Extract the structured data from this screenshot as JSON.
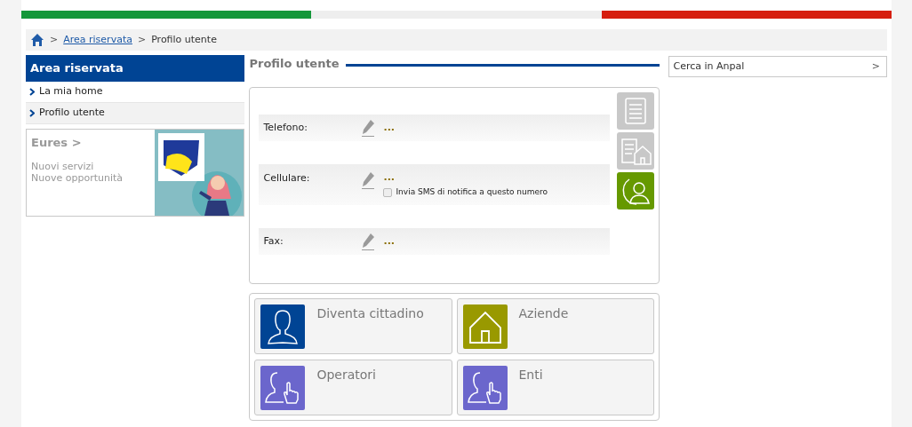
{
  "breadcrumb": {
    "links": [
      "Area riservata"
    ],
    "separator": ">",
    "current": "Profilo utente"
  },
  "sidebar": {
    "title": "Area riservata",
    "items": [
      {
        "label": "La mia home",
        "selected": false
      },
      {
        "label": "Profilo utente",
        "selected": true
      }
    ]
  },
  "promo": {
    "title": "Eures >",
    "lines": [
      "Nuovi servizi",
      "Nuove opportunità"
    ]
  },
  "page_title": "Profilo utente",
  "fields": [
    {
      "label": "Telefono:",
      "value": "..."
    },
    {
      "label": "Cellulare:",
      "value": "...",
      "checkbox": {
        "label": "Invia SMS di notifica a questo numero",
        "checked": false
      }
    },
    {
      "label": "Fax:",
      "value": "..."
    }
  ],
  "side_tabs": [
    {
      "kind": "document",
      "selected": false
    },
    {
      "kind": "address",
      "selected": false
    },
    {
      "kind": "contacts",
      "selected": true
    }
  ],
  "tiles": [
    {
      "label": "Diventa cittadino",
      "kind": "person",
      "color": "#004494"
    },
    {
      "label": "Aziende",
      "kind": "house",
      "color": "#999900"
    },
    {
      "label": "Operatori",
      "kind": "pointer",
      "color": "#6b66cc"
    },
    {
      "label": "Enti",
      "kind": "pointer",
      "color": "#6b66cc"
    }
  ],
  "search": {
    "placeholder": "Cerca in Anpal",
    "button": ">"
  }
}
